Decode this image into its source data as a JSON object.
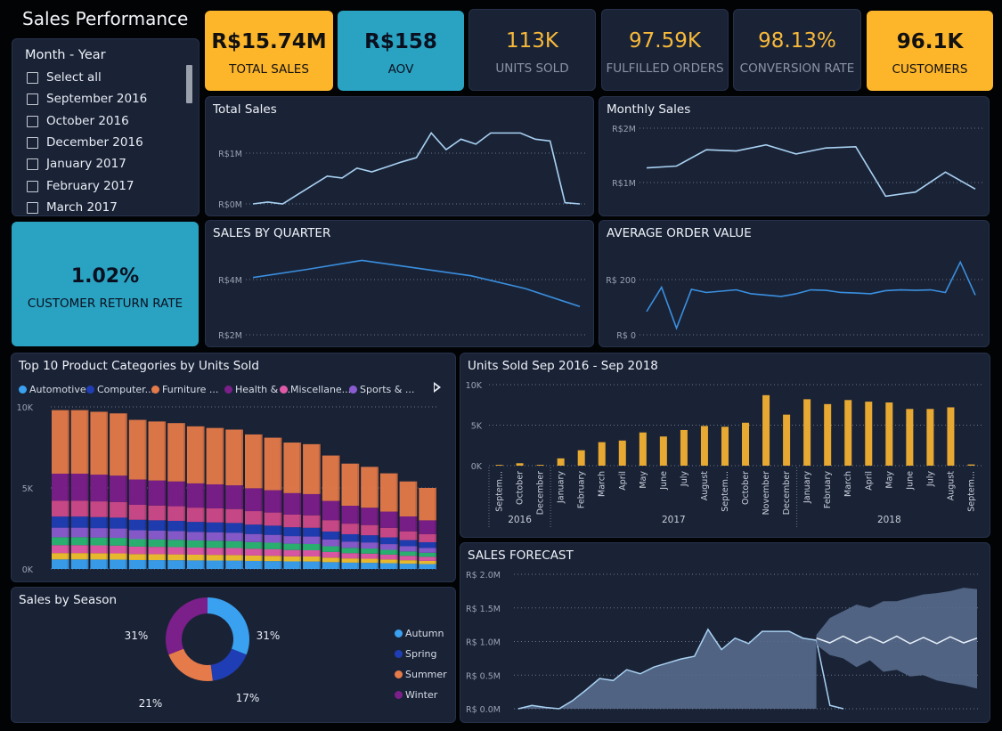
{
  "page_title": "Sales Performance",
  "slicer": {
    "title": "Month - Year",
    "items": [
      "Select all",
      "September 2016",
      "October 2016",
      "December 2016",
      "January 2017",
      "February 2017",
      "March 2017"
    ]
  },
  "kpis": [
    {
      "value": "R$15.74M",
      "label": "TOTAL SALES",
      "style": "yellow"
    },
    {
      "value": "R$158",
      "label": "AOV",
      "style": "teal"
    },
    {
      "value": "113K",
      "label": "UNITS SOLD",
      "style": "dark"
    },
    {
      "value": "97.59K",
      "label": "FULFILLED ORDERS",
      "style": "dark"
    },
    {
      "value": "98.13%",
      "label": "CONVERSION RATE",
      "style": "dark"
    },
    {
      "value": "96.1K",
      "label": "CUSTOMERS",
      "style": "yellow"
    }
  ],
  "return_rate": {
    "value": "1.02%",
    "label": "CUSTOMER RETURN RATE"
  },
  "colors": {
    "yellow": "#fdb52a",
    "teal": "#2aa3c2",
    "panel": "#1a2336",
    "line": "#a9d1f2",
    "bar": "#e8a932"
  },
  "chart_data": [
    {
      "id": "total_sales",
      "type": "line",
      "title": "Total Sales",
      "y_ticks": [
        "R$0M",
        "R$1M"
      ],
      "ylim": [
        0,
        1.3
      ],
      "values": [
        0.0,
        0.03,
        0.0,
        0.15,
        0.3,
        0.45,
        0.42,
        0.58,
        0.52,
        0.6,
        0.68,
        0.75,
        1.15,
        0.88,
        1.05,
        0.97,
        1.15,
        1.15,
        1.15,
        1.05,
        1.02,
        0.02,
        0.0
      ]
    },
    {
      "id": "monthly_sales",
      "type": "line",
      "title": "Monthly Sales",
      "y_ticks": [
        "R$1M",
        "R$2M"
      ],
      "ylim": [
        0.6,
        2.0
      ],
      "values": [
        1.27,
        1.3,
        1.57,
        1.55,
        1.65,
        1.5,
        1.6,
        1.62,
        0.8,
        0.87,
        1.2,
        0.92
      ]
    },
    {
      "id": "sales_by_quarter",
      "type": "line",
      "title": "SALES BY QUARTER",
      "y_ticks": [
        "R$2M",
        "R$4M"
      ],
      "ylim": [
        1.8,
        5.2
      ],
      "values": [
        4.03,
        4.35,
        4.7,
        4.4,
        4.1,
        3.6,
        2.9
      ]
    },
    {
      "id": "aov",
      "type": "line",
      "title": "AVERAGE ORDER VALUE",
      "y_ticks": [
        "R$ 0",
        "R$ 200"
      ],
      "ylim": [
        0,
        330
      ],
      "values": [
        88,
        180,
        25,
        172,
        160,
        165,
        170,
        155,
        150,
        145,
        155,
        170,
        168,
        160,
        158,
        155,
        167,
        170,
        168,
        170,
        160,
        275,
        150
      ]
    },
    {
      "id": "units_sold",
      "type": "bar",
      "title": "Units Sold Sep 2016 - Sep 2018",
      "y_ticks": [
        "0K",
        "5K",
        "10K"
      ],
      "ylim": [
        0,
        10000
      ],
      "categories": [
        "September",
        "October",
        "December",
        "January",
        "February",
        "March",
        "April",
        "May",
        "June",
        "July",
        "August",
        "September",
        "October",
        "November",
        "December",
        "January",
        "February",
        "March",
        "April",
        "May",
        "June",
        "July",
        "August",
        "September"
      ],
      "values": [
        100,
        300,
        100,
        900,
        1900,
        2900,
        3100,
        4100,
        3600,
        4400,
        4900,
        4800,
        5300,
        8700,
        6300,
        8200,
        7600,
        8100,
        7900,
        7800,
        7000,
        7000,
        7200,
        150
      ],
      "year_labels": [
        "2016",
        "2017",
        "2018"
      ]
    },
    {
      "id": "season",
      "type": "pie",
      "title": "Sales by Season",
      "categories": [
        "Autumn",
        "Spring",
        "Summer",
        "Winter"
      ],
      "values": [
        31,
        17,
        21,
        31
      ],
      "labels": [
        "31%",
        "17%",
        "21%",
        "31%"
      ],
      "colors": [
        "#3aa0f0",
        "#1f3eb5",
        "#e57a4a",
        "#7b1f8a"
      ]
    },
    {
      "id": "forecast",
      "type": "area",
      "title": "SALES FORECAST",
      "y_ticks": [
        "R$ 0.0M",
        "R$ 0.5M",
        "R$ 1.0M",
        "R$ 1.5M",
        "R$ 2.0M"
      ],
      "ylim": [
        0,
        2.0
      ],
      "actual": [
        0.0,
        0.05,
        0.02,
        0.0,
        0.12,
        0.28,
        0.45,
        0.42,
        0.58,
        0.52,
        0.62,
        0.68,
        0.74,
        0.78,
        1.18,
        0.88,
        1.05,
        0.97,
        1.15,
        1.15,
        1.15,
        1.05,
        1.02,
        0.05,
        0.0
      ],
      "forecast": [
        1.05,
        0.98,
        1.08,
        0.98,
        1.07,
        0.98,
        1.08,
        0.97,
        1.06,
        0.97,
        1.07,
        0.98,
        1.05
      ],
      "upper": [
        1.1,
        1.35,
        1.45,
        1.55,
        1.5,
        1.6,
        1.6,
        1.65,
        1.7,
        1.72,
        1.75,
        1.8,
        1.78
      ],
      "lower": [
        0.95,
        0.8,
        0.75,
        0.62,
        0.72,
        0.55,
        0.58,
        0.48,
        0.5,
        0.42,
        0.38,
        0.35,
        0.3
      ]
    },
    {
      "id": "top10",
      "type": "area",
      "title": "Top 10 Product Categories by Units Sold",
      "y_ticks": [
        "0K",
        "5K",
        "10K"
      ],
      "ylim": [
        0,
        10000
      ],
      "legend": [
        "Automotive",
        "Computer...",
        "Furniture ...",
        "Health & ...",
        "Miscellane...",
        "Sports & ..."
      ],
      "legend_colors": [
        "#3aa0f0",
        "#1f3eb5",
        "#e57a4a",
        "#7b1f8a",
        "#e15aa8",
        "#8a5cd0"
      ],
      "totals": [
        9800,
        9800,
        9700,
        9600,
        9200,
        9100,
        9000,
        8800,
        8700,
        8600,
        8300,
        8100,
        7800,
        7700,
        7000,
        6500,
        6300,
        5900,
        5400,
        5000
      ]
    }
  ]
}
